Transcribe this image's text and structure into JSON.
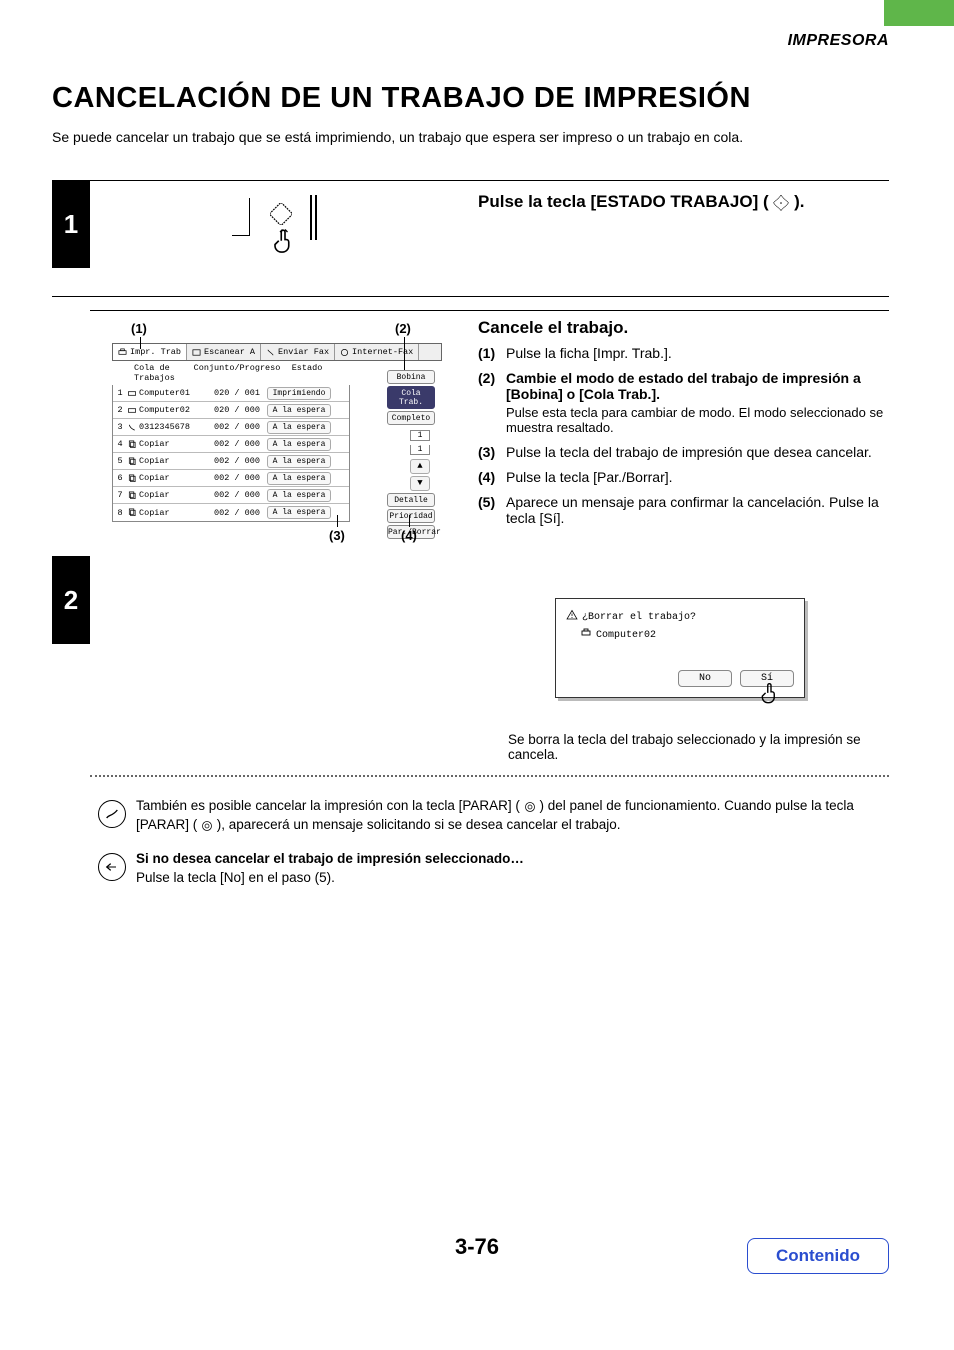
{
  "header": {
    "section": "IMPRESORA"
  },
  "title": "CANCELACIÓN DE UN TRABAJO DE IMPRESIÓN",
  "intro": "Se puede cancelar un trabajo que se está imprimiendo, un trabajo que espera ser impreso o un trabajo en cola.",
  "step1": {
    "num": "1",
    "title_a": "Pulse la tecla [ESTADO TRABAJO] (",
    "title_b": ")."
  },
  "step2": {
    "num": "2",
    "title": "Cancele el trabajo.",
    "callouts": {
      "c1": "(1)",
      "c2": "(2)",
      "c3": "(3)",
      "c4": "(4)"
    },
    "items": [
      {
        "n": "(1)",
        "bold": "Pulse la ficha [Impr. Trab.]."
      },
      {
        "n": "(2)",
        "bold": "Cambie el modo de estado del trabajo de impresión a [Bobina] o [Cola Trab.].",
        "sub": "Pulse esta tecla para cambiar de modo. El modo seleccionado se muestra resaltado."
      },
      {
        "n": "(3)",
        "bold": "Pulse la tecla del trabajo de impresión que desea cancelar."
      },
      {
        "n": "(4)",
        "bold": "Pulse la tecla [Par./Borrar]."
      },
      {
        "n": "(5)",
        "bold": "Aparece un mensaje para confirmar la cancelación. Pulse la tecla [Sí]."
      }
    ],
    "tabs": [
      {
        "label": "Impr. Trab"
      },
      {
        "label": "Escanear A"
      },
      {
        "label": "Enviar Fax"
      },
      {
        "label": "Internet-Fax"
      }
    ],
    "columns": {
      "a": "Cola de Trabajos",
      "b": "Conjunto/Progreso",
      "c": "Estado"
    },
    "jobs": [
      {
        "n": "1",
        "name": "Computer01",
        "prog": "020 / 001",
        "st": "Imprimiendo"
      },
      {
        "n": "2",
        "name": "Computer02",
        "prog": "020 / 000",
        "st": "A la espera"
      },
      {
        "n": "3",
        "name": "0312345678",
        "prog": "002 / 000",
        "st": "A la espera"
      },
      {
        "n": "4",
        "name": "Copiar",
        "prog": "002 / 000",
        "st": "A la espera"
      },
      {
        "n": "5",
        "name": "Copiar",
        "prog": "002 / 000",
        "st": "A la espera"
      },
      {
        "n": "6",
        "name": "Copiar",
        "prog": "002 / 000",
        "st": "A la espera"
      },
      {
        "n": "7",
        "name": "Copiar",
        "prog": "002 / 000",
        "st": "A la espera"
      },
      {
        "n": "8",
        "name": "Copiar",
        "prog": "002 / 000",
        "st": "A la espera"
      }
    ],
    "side": {
      "bobina": "Bobina",
      "cola": "Cola Trab.",
      "completo": "Completo",
      "page_top": "1",
      "page_bot": "1",
      "up": "▲",
      "down": "▼",
      "detalle": "Detalle",
      "prioridad": "Prioridad",
      "parborrar": "Par./Borrar"
    },
    "dialog": {
      "question": "¿Borrar el trabajo?",
      "name": "Computer02",
      "no": "No",
      "si": "Sí"
    },
    "after": "Se borra la tecla del trabajo seleccionado y la impresión se cancela."
  },
  "notes": {
    "n1a": "También es posible cancelar la impresión con la tecla [PARAR] (",
    "n1b": ") del panel de funcionamiento. Cuando pulse la tecla [PARAR] (",
    "n1c": "), aparecerá un mensaje solicitando si se desea cancelar el trabajo.",
    "n2_bold": "Si no desea cancelar el trabajo de impresión seleccionado…",
    "n2": "Pulse la tecla [No] en el paso (5)."
  },
  "footer": {
    "page": "3-76",
    "contents": "Contenido"
  }
}
